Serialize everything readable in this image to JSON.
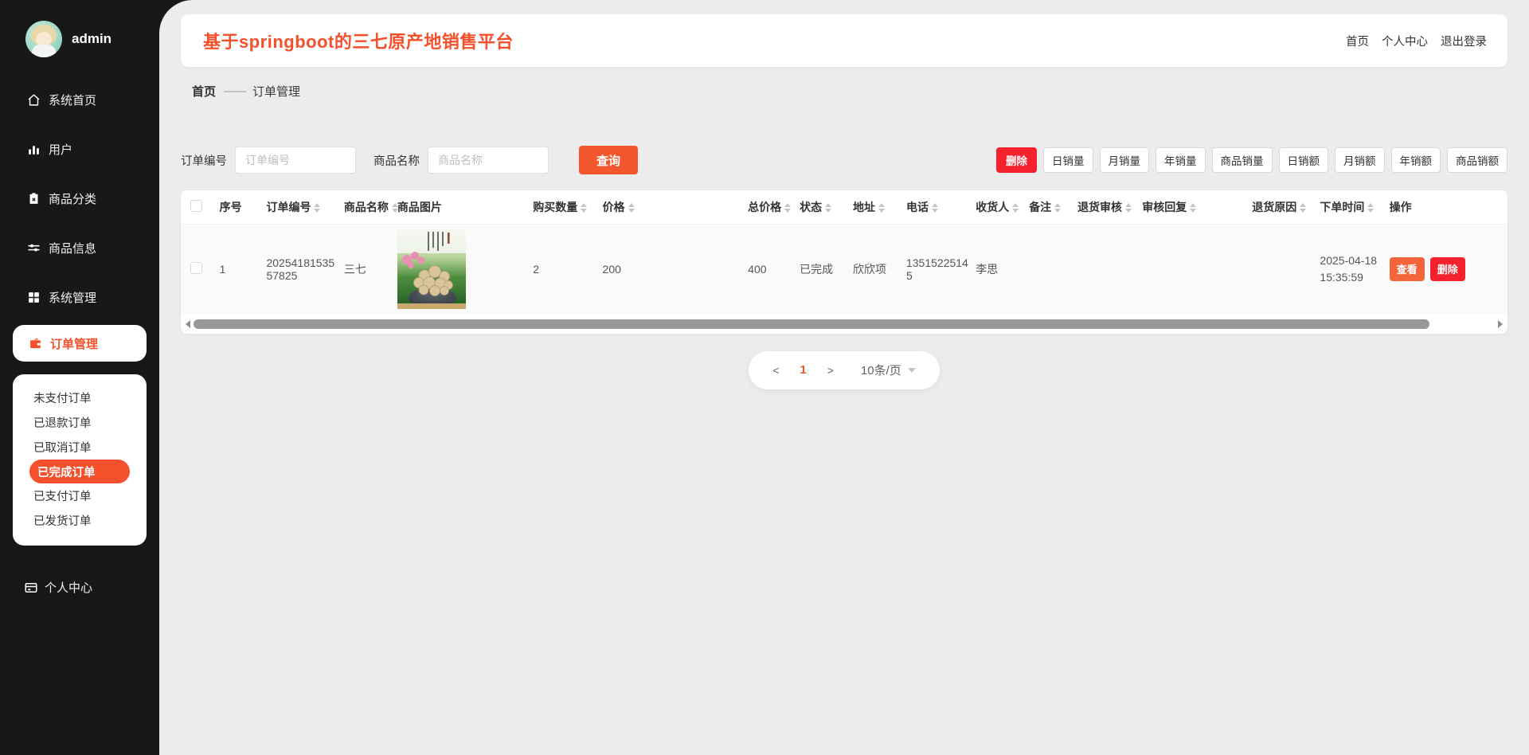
{
  "app": {
    "title": "基于springboot的三七原产地销售平台"
  },
  "topnav": {
    "links": [
      "首页",
      "个人中心",
      "退出登录"
    ]
  },
  "sidebar": {
    "username": "admin",
    "items": [
      {
        "label": "系统首页",
        "icon": "home-icon"
      },
      {
        "label": "用户",
        "icon": "bar-chart-icon"
      },
      {
        "label": "商品分类",
        "icon": "clipboard-icon"
      },
      {
        "label": "商品信息",
        "icon": "sliders-icon"
      },
      {
        "label": "系统管理",
        "icon": "grid-icon"
      },
      {
        "label": "订单管理",
        "icon": "wallet-icon"
      }
    ],
    "active_item": "订单管理",
    "submenu": {
      "items": [
        "未支付订单",
        "已退款订单",
        "已取消订单",
        "已完成订单",
        "已支付订单",
        "已发货订单"
      ],
      "active": "已完成订单"
    },
    "personal_center": "个人中心"
  },
  "breadcrumb": {
    "home": "首页",
    "separator": "——",
    "current": "订单管理"
  },
  "toolbar": {
    "order_no_label": "订单编号",
    "order_no_placeholder": "订单编号",
    "order_no_value": "",
    "product_label": "商品名称",
    "product_placeholder": "商品名称",
    "product_value": "",
    "search_label": "查询",
    "delete_label": "删除",
    "stat_buttons": [
      "日销量",
      "月销量",
      "年销量",
      "商品销量",
      "日销额",
      "月销额",
      "年销额",
      "商品销额"
    ]
  },
  "table": {
    "columns": [
      "序号",
      "订单编号",
      "商品名称",
      "商品图片",
      "购买数量",
      "价格",
      "总价格",
      "状态",
      "地址",
      "电话",
      "收货人",
      "备注",
      "退货审核",
      "审核回复",
      "退货原因",
      "下单时间",
      "操作"
    ],
    "rows": [
      {
        "index": "1",
        "order_no": "2025418153557825",
        "product_name": "三七",
        "product_image": "sanqi-root-bowl-photo",
        "quantity": "2",
        "price": "200",
        "total": "400",
        "status": "已完成",
        "address": "欣欣项",
        "phone": "13515225145",
        "consignee": "李思",
        "remark": "",
        "return_audit": "",
        "audit_reply": "",
        "return_reason": "",
        "order_date": "2025-04-18",
        "order_time": "15:35:59",
        "view_label": "查看",
        "delete_label": "删除"
      }
    ]
  },
  "pagination": {
    "prev": "<",
    "page": "1",
    "next": ">",
    "page_size": "10条/页"
  },
  "colors": {
    "accent": "#f4502b",
    "danger": "#f5222d",
    "sidebar_bg": "#181818",
    "page_bg": "#ececec"
  }
}
